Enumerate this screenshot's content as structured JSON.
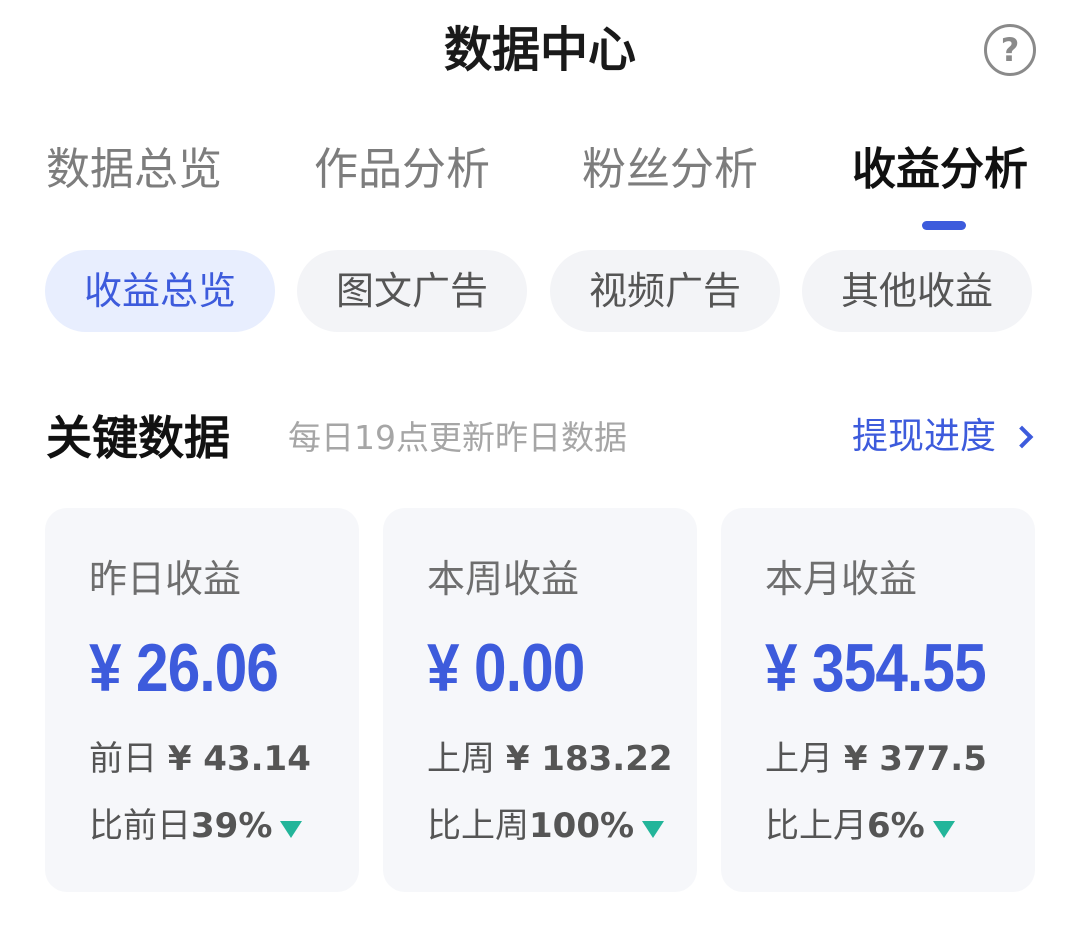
{
  "header": {
    "title": "数据中心",
    "help_icon": "question-mark-circle-icon"
  },
  "main_tabs": [
    {
      "label": "数据总览",
      "active": false
    },
    {
      "label": "作品分析",
      "active": false
    },
    {
      "label": "粉丝分析",
      "active": false
    },
    {
      "label": "收益分析",
      "active": true
    }
  ],
  "sub_tabs": [
    {
      "label": "收益总览",
      "active": true
    },
    {
      "label": "图文广告",
      "active": false
    },
    {
      "label": "视频广告",
      "active": false
    },
    {
      "label": "其他收益",
      "active": false
    }
  ],
  "section": {
    "title": "关键数据",
    "note": "每日19点更新昨日数据",
    "link_label": "提现进度"
  },
  "cards": [
    {
      "label": "昨日收益",
      "value": "¥ 26.06",
      "prev_label": "前日",
      "prev_value": "¥ 43.14",
      "compare_label": "比前日",
      "compare_pct": "39%",
      "trend": "down"
    },
    {
      "label": "本周收益",
      "value": "¥ 0.00",
      "prev_label": "上周",
      "prev_value": "¥ 183.22",
      "compare_label": "比上周",
      "compare_pct": "100%",
      "trend": "down"
    },
    {
      "label": "本月收益",
      "value": "¥ 354.55",
      "prev_label": "上月",
      "prev_value": "¥ 377.5",
      "compare_label": "比上月",
      "compare_pct": "6%",
      "trend": "down"
    }
  ],
  "colors": {
    "accent": "#3d5bdc",
    "down_trend": "#23b59a",
    "card_bg": "#f6f7fa",
    "active_chip_bg": "#e8eefe"
  }
}
